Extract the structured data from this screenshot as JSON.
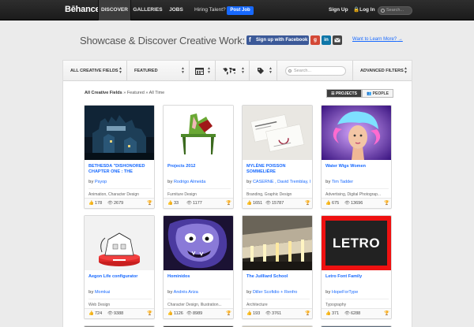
{
  "nav": {
    "logo": "Bēhance",
    "tabs": [
      {
        "label": "DISCOVER",
        "active": true
      },
      {
        "label": "GALLERIES",
        "active": false
      },
      {
        "label": "JOBS",
        "active": false
      }
    ],
    "hiring_label": "Hiring Talent?",
    "post_job_label": "Post Job",
    "signup_label": "Sign Up",
    "login_label": "Log In",
    "search_placeholder": "Search...",
    "accent_color": "#1769ff"
  },
  "hero": {
    "title": "Showcase & Discover Creative Work:",
    "facebook_label": "Sign up with Facebook",
    "google_label": "g",
    "linkedin_label": "in",
    "learn_more": "Want to Learn More?",
    "facebook_color": "#3b5998",
    "google_color": "#d34836",
    "linkedin_color": "#0e76a8"
  },
  "filters": {
    "creative_fields": "ALL CREATIVE FIELDS",
    "sort": "FEATURED",
    "search_placeholder": "Search...",
    "advanced": "ADVANCED FILTERS",
    "icons": [
      "calendar-icon",
      "world-map-icon",
      "tag-icon"
    ]
  },
  "breadcrumb": {
    "field": "All Creative Fields",
    "sort": "Featured",
    "time": "All Time",
    "separator": "»"
  },
  "view_toggle": {
    "projects": "PROJECTS",
    "people": "PEOPLE"
  },
  "projects": [
    {
      "title": "BETHESDA \"DISHONORED CHAPTER ONE : THE",
      "by": "by",
      "author": "Psyop",
      "fields": "Animation, Character Design",
      "appreciations": "178",
      "views": "2679"
    },
    {
      "title": "Projects 2012",
      "by": "by",
      "author": "Rodrigo Almeida",
      "fields": "Furniture Design",
      "appreciations": "33",
      "views": "1177"
    },
    {
      "title": "MYLÈNE POISSON SOMMELIÈRE",
      "by": "by",
      "author": "CASERNE , David Tremblay, I",
      "fields": "Branding, Graphic Design",
      "appreciations": "1651",
      "views": "15787"
    },
    {
      "title": "Water Wigs Women",
      "by": "by",
      "author": "Tim Tadder",
      "fields": "Advertising, Digital Photograp...",
      "appreciations": "675",
      "views": "13696"
    },
    {
      "title": "Aegon Life configurator",
      "by": "by",
      "author": "Momkai",
      "fields": "Web Design",
      "appreciations": "724",
      "views": "9388"
    },
    {
      "title": "Hominidos",
      "by": "by",
      "author": "Andrés Ariza",
      "fields": "Character Design, Illustration...",
      "appreciations": "1126",
      "views": "8989"
    },
    {
      "title": "The Juilliard School",
      "by": "by",
      "author": "Diller Scofidio + Renfro",
      "fields": "Architecture",
      "appreciations": "193",
      "views": "3761"
    },
    {
      "title": "Letro Font Family",
      "by": "by",
      "author": "HopeForType",
      "fields": "Typography",
      "appreciations": "371",
      "views": "6288",
      "thumb_text": "LETRO"
    }
  ]
}
